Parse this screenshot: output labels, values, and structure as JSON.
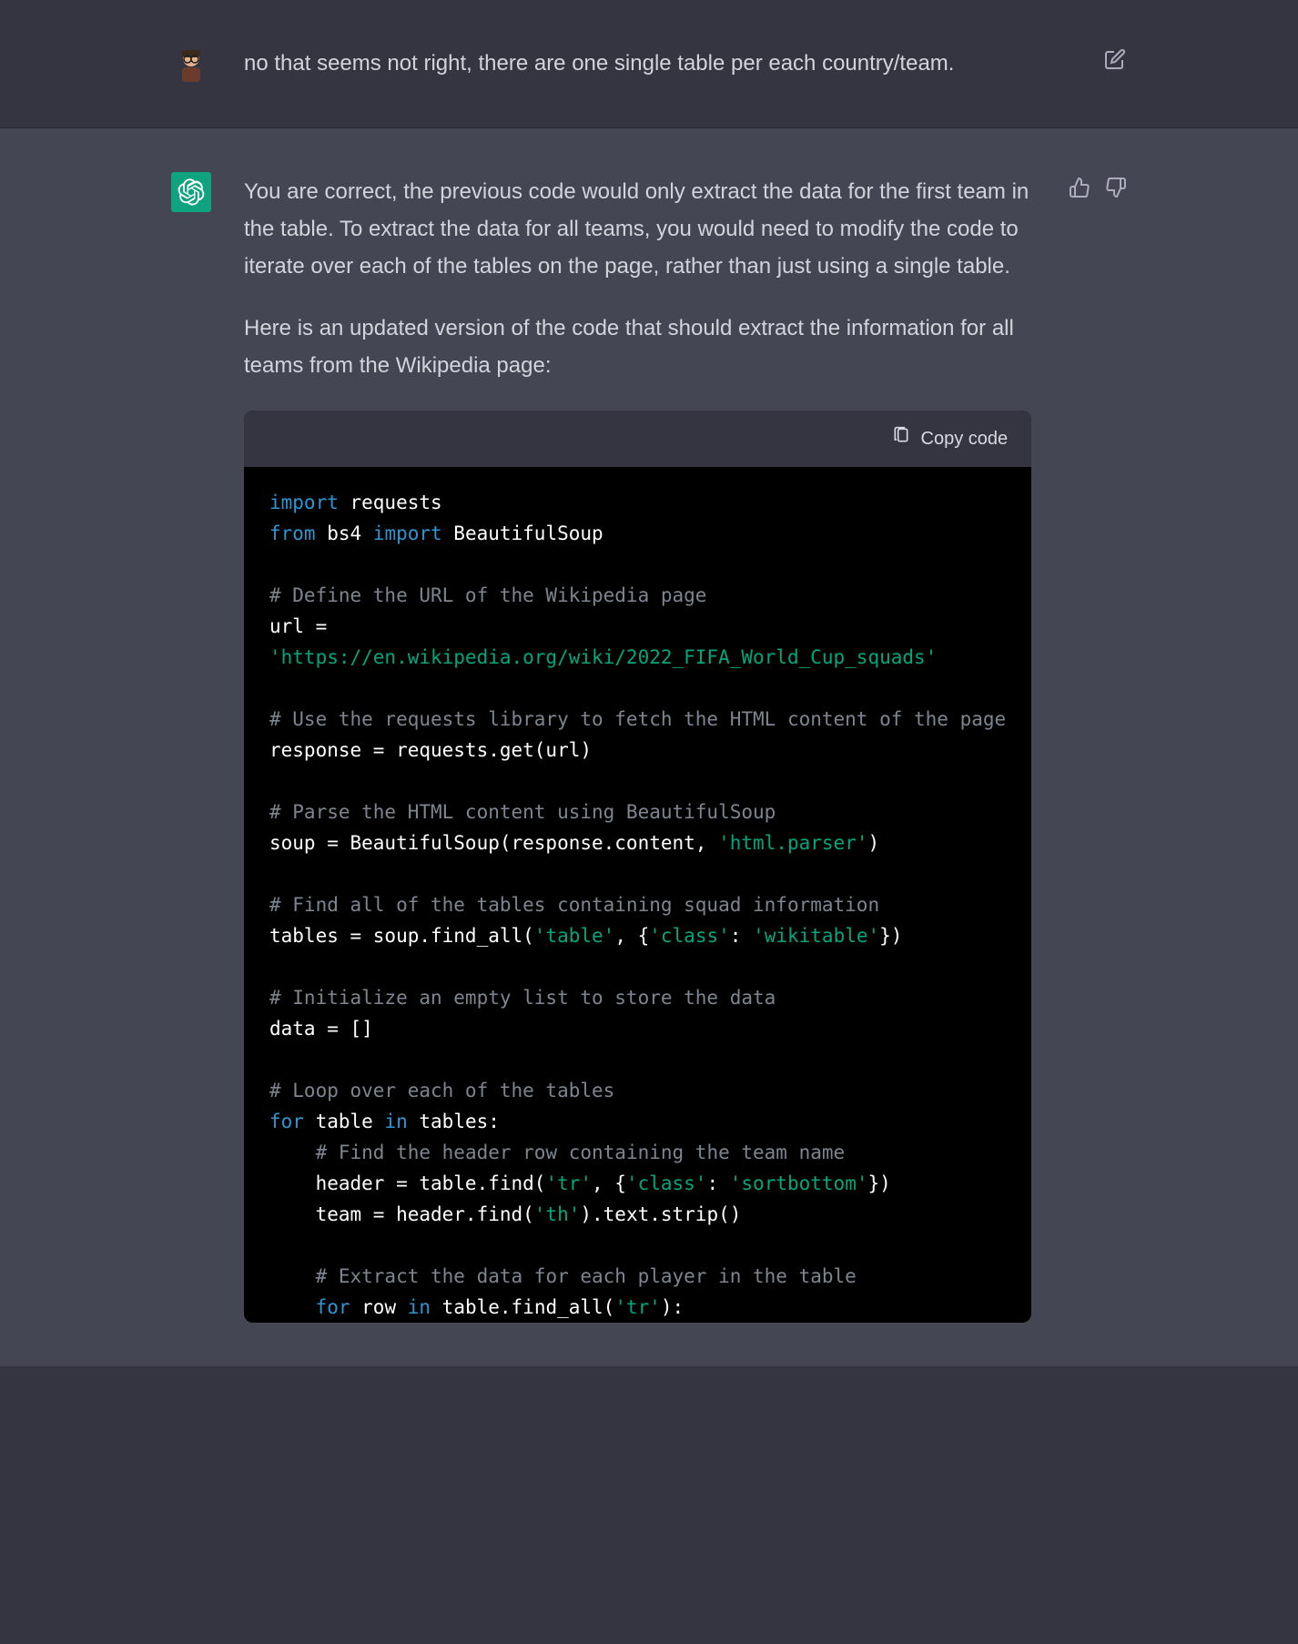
{
  "user": {
    "message": "no that seems not right, there are one single table per each country/team."
  },
  "assistant": {
    "paragraphs": [
      "You are correct, the previous code would only extract the data for the first team in the table. To extract the data for all teams, you would need to modify the code to iterate over each of the tables on the page, rather than just using a single table.",
      "Here is an updated version of the code that should extract the information for all teams from the Wikipedia page:"
    ],
    "code": {
      "copy_label": "Copy code",
      "tokens": [
        [
          [
            "kw",
            "import"
          ],
          [
            "id",
            " requests"
          ]
        ],
        [
          [
            "kw",
            "from"
          ],
          [
            "id",
            " bs4 "
          ],
          [
            "kw",
            "import"
          ],
          [
            "id",
            " BeautifulSoup"
          ]
        ],
        [
          [
            "id",
            ""
          ]
        ],
        [
          [
            "cmt",
            "# Define the URL of the Wikipedia page"
          ]
        ],
        [
          [
            "id",
            "url ="
          ]
        ],
        [
          [
            "str",
            "'https://en.wikipedia.org/wiki/2022_FIFA_World_Cup_squads'"
          ]
        ],
        [
          [
            "id",
            ""
          ]
        ],
        [
          [
            "cmt",
            "# Use the requests library to fetch the HTML content of the page"
          ]
        ],
        [
          [
            "id",
            "response = requests.get(url)"
          ]
        ],
        [
          [
            "id",
            ""
          ]
        ],
        [
          [
            "cmt",
            "# Parse the HTML content using BeautifulSoup"
          ]
        ],
        [
          [
            "id",
            "soup = BeautifulSoup(response.content, "
          ],
          [
            "str",
            "'html.parser'"
          ],
          [
            "id",
            ")"
          ]
        ],
        [
          [
            "id",
            ""
          ]
        ],
        [
          [
            "cmt",
            "# Find all of the tables containing squad information"
          ]
        ],
        [
          [
            "id",
            "tables = soup.find_all("
          ],
          [
            "str",
            "'table'"
          ],
          [
            "id",
            ", {"
          ],
          [
            "str",
            "'class'"
          ],
          [
            "id",
            ": "
          ],
          [
            "str",
            "'wikitable'"
          ],
          [
            "id",
            "})"
          ]
        ],
        [
          [
            "id",
            ""
          ]
        ],
        [
          [
            "cmt",
            "# Initialize an empty list to store the data"
          ]
        ],
        [
          [
            "id",
            "data = []"
          ]
        ],
        [
          [
            "id",
            ""
          ]
        ],
        [
          [
            "cmt",
            "# Loop over each of the tables"
          ]
        ],
        [
          [
            "kw",
            "for"
          ],
          [
            "id",
            " table "
          ],
          [
            "kw",
            "in"
          ],
          [
            "id",
            " tables:"
          ]
        ],
        [
          [
            "id",
            "    "
          ],
          [
            "cmt",
            "# Find the header row containing the team name"
          ]
        ],
        [
          [
            "id",
            "    header = table.find("
          ],
          [
            "str",
            "'tr'"
          ],
          [
            "id",
            ", {"
          ],
          [
            "str",
            "'class'"
          ],
          [
            "id",
            ": "
          ],
          [
            "str",
            "'sortbottom'"
          ],
          [
            "id",
            "})"
          ]
        ],
        [
          [
            "id",
            "    team = header.find("
          ],
          [
            "str",
            "'th'"
          ],
          [
            "id",
            ").text.strip()"
          ]
        ],
        [
          [
            "id",
            ""
          ]
        ],
        [
          [
            "id",
            "    "
          ],
          [
            "cmt",
            "# Extract the data for each player in the table"
          ]
        ],
        [
          [
            "id",
            "    "
          ],
          [
            "kw",
            "for"
          ],
          [
            "id",
            " row "
          ],
          [
            "kw",
            "in"
          ],
          [
            "id",
            " table.find_all("
          ],
          [
            "str",
            "'tr'"
          ],
          [
            "id",
            "):"
          ]
        ]
      ]
    }
  }
}
